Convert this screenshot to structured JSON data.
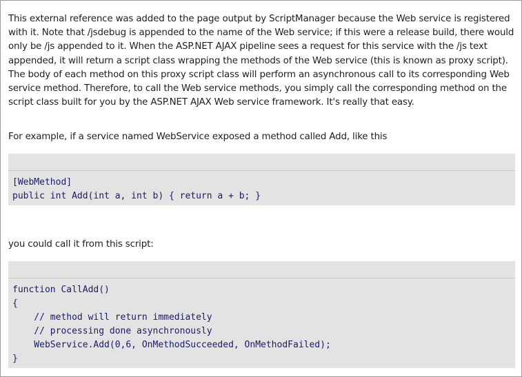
{
  "paragraphs": {
    "intro": "This external reference was added to the page output by ScriptManager because the Web service is registered with it. Note that /jsdebug is appended to the name of the Web service; if this were a release build, there would only be /js appended to it. When the ASP.NET AJAX pipeline sees a request for this service with the /js text appended, it will return a script class wrapping the methods of the Web service (this is known as proxy script). The body of each method on this proxy script class will perform an asynchronous call to its corresponding Web service method. Therefore, to call the Web service methods, you simply call the corresponding method on the script class built for you by the ASP.NET AJAX Web service framework. It's really that easy.",
    "example": "For example, if a service named WebService exposed a method called Add, like this",
    "call": "you could call it from this script:"
  },
  "code_blocks": {
    "webmethod": "[WebMethod]\npublic int Add(int a, int b) { return a + b; }",
    "script": "function CallAdd()\n{\n    // method will return immediately\n    // processing done asynchronously\n    WebService.Add(0,6, OnMethodSucceeded, OnMethodFailed);\n}"
  }
}
